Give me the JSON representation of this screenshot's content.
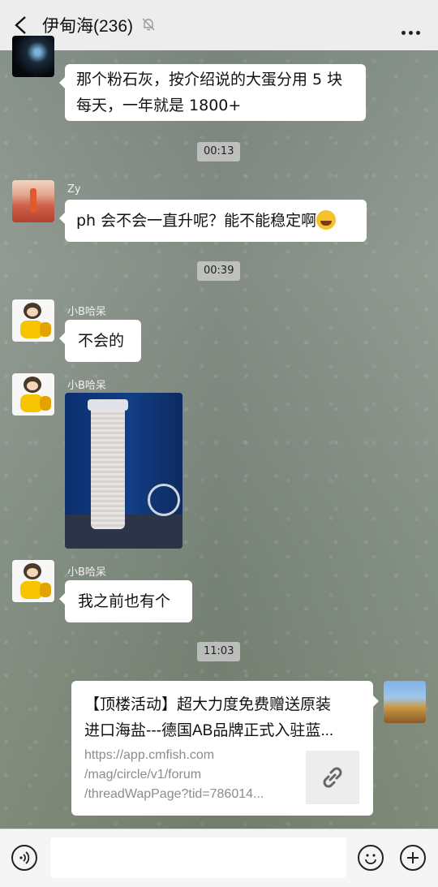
{
  "header": {
    "title": "伊甸海(236)"
  },
  "messages": [
    {
      "type": "text",
      "text": "那个粉石灰，按介绍说的大蛋分用 5 块每天，一年就是 1800+"
    },
    {
      "type": "time",
      "text": "00:13"
    },
    {
      "type": "text",
      "sender": "Zy",
      "text": "ph 会不会一直升呢？能不能稳定啊"
    },
    {
      "type": "time",
      "text": "00:39"
    },
    {
      "type": "text",
      "sender": "小B哈呆",
      "text": "不会的"
    },
    {
      "type": "image",
      "sender": "小B哈呆"
    },
    {
      "type": "text",
      "sender": "小B哈呆",
      "text": "我之前也有个"
    },
    {
      "type": "time",
      "text": "11:03"
    }
  ],
  "link_card": {
    "title_line1": "【顶楼活动】超大力度免费赠送原装",
    "title_line2": "进口海盐---德国AB品牌正式入驻蓝...",
    "url_line1": "https://app.cmfish.com",
    "url_line2": "/mag/circle/v1/forum",
    "url_line3": "/threadWapPage?tid=786014..."
  }
}
